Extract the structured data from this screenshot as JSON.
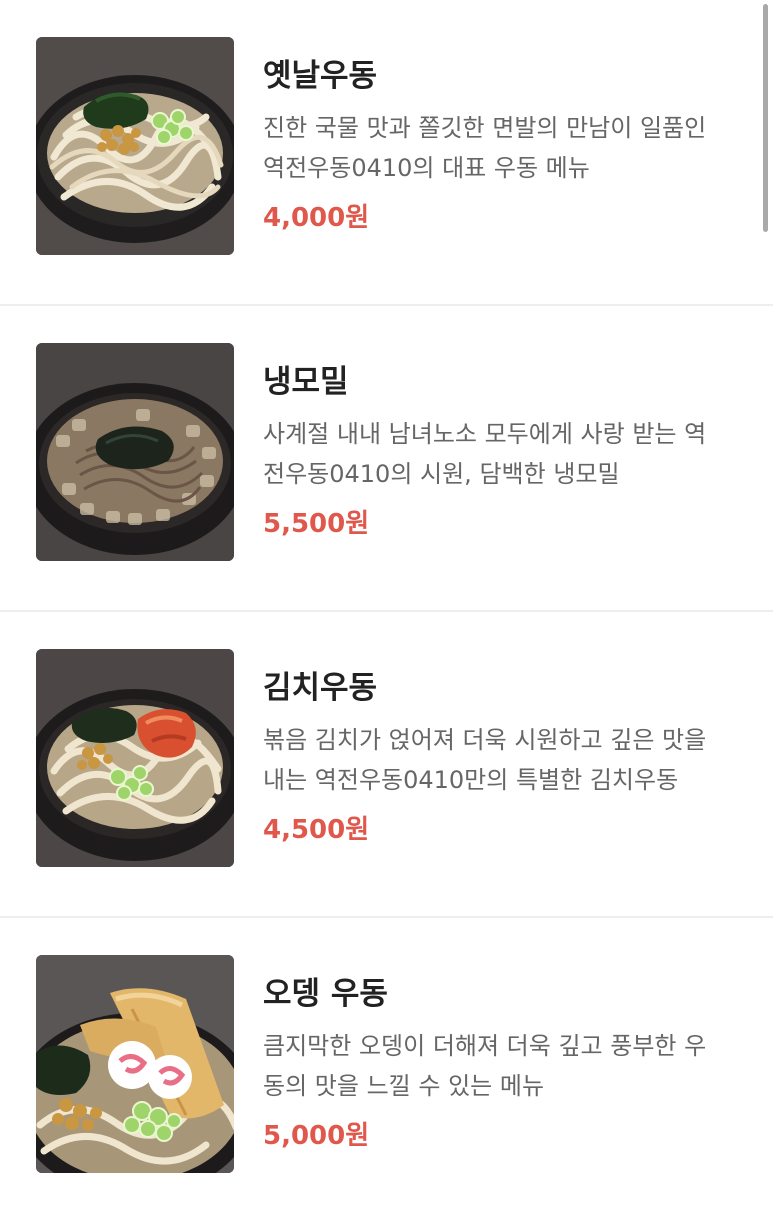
{
  "menu": {
    "items": [
      {
        "name": "옛날우동",
        "desc_lines": [
          "진한 국물 맛과 쫄깃한 면발의 만남이 일품인",
          "역전우동0410의 대표 우동 메뉴"
        ],
        "price": "4,000원",
        "image_icon": "udon-bowl-icon"
      },
      {
        "name": "냉모밀",
        "desc_lines": [
          "사계절 내내 남녀노소 모두에게 사랑 받는 역",
          "전우동0410의 시원, 담백한 냉모밀"
        ],
        "price": "5,500원",
        "image_icon": "cold-soba-bowl-icon"
      },
      {
        "name": "김치우동",
        "desc_lines": [
          "볶음 김치가 얹어져 더욱 시원하고 깊은 맛을",
          "내는 역전우동0410만의 특별한 김치우동"
        ],
        "price": "4,500원",
        "image_icon": "kimchi-udon-bowl-icon"
      },
      {
        "name": "오뎅 우동",
        "desc_lines": [
          "큼지막한 오뎅이 더해져 더욱 깊고 풍부한 우",
          "동의 맛을 느낄 수 있는 메뉴"
        ],
        "price": "5,000원",
        "image_icon": "odeng-udon-bowl-icon"
      }
    ]
  },
  "colors": {
    "price": "#e0574b",
    "title": "#222222",
    "description": "#666666",
    "divider": "#eeeeee"
  }
}
